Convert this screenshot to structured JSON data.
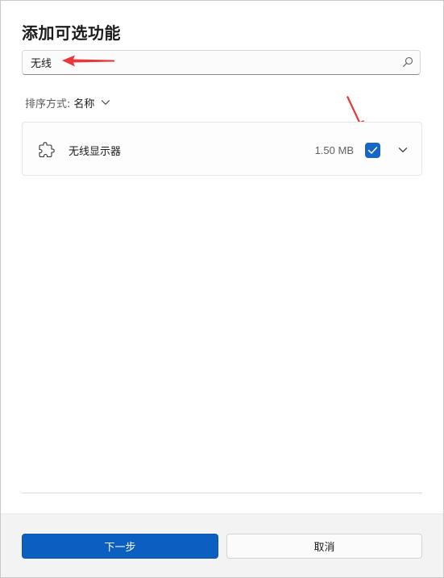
{
  "dialog": {
    "title": "添加可选功能"
  },
  "search": {
    "value": "无线",
    "icon": "search-icon"
  },
  "sort": {
    "label": "排序方式:",
    "value": "名称",
    "icon": "chevron-down-icon"
  },
  "features": [
    {
      "name": "无线显示器",
      "size": "1.50 MB",
      "checked": true,
      "icon": "puzzle-piece-icon",
      "expand_icon": "chevron-down-icon"
    }
  ],
  "footer": {
    "next_label": "下一步",
    "cancel_label": "取消"
  },
  "colors": {
    "accent": "#0b5fc0",
    "annotation_arrow": "#e8373a",
    "footer_bg": "#f3f3f3"
  }
}
